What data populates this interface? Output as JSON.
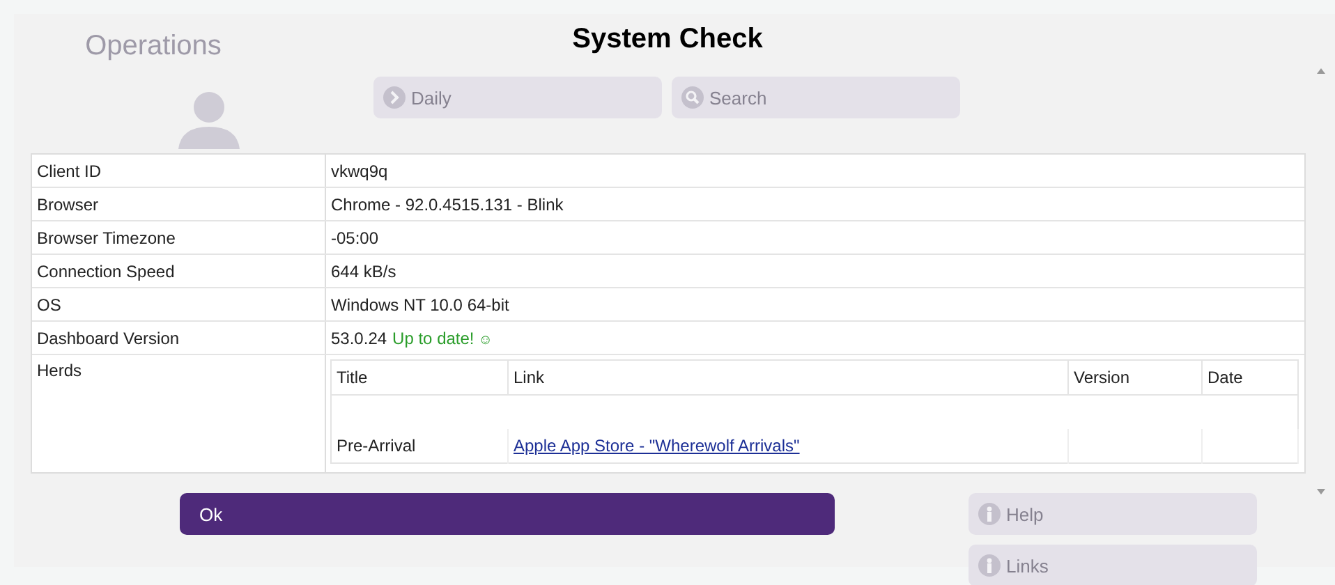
{
  "background_page": {
    "heading": "Operations",
    "buttons": [
      {
        "kind": "chevron",
        "label": "Daily"
      },
      {
        "kind": "search",
        "label": "Search"
      }
    ],
    "side_buttons": [
      {
        "kind": "info",
        "label": "Help"
      },
      {
        "kind": "info",
        "label": "Links"
      }
    ]
  },
  "dialog": {
    "title": "System Check",
    "info_rows": [
      {
        "label": "Client ID",
        "value": "vkwq9q"
      },
      {
        "label": "Browser",
        "value": "Chrome - 92.0.4515.131 - Blink"
      },
      {
        "label": "Browser Timezone",
        "value": "-05:00"
      },
      {
        "label": "Connection Speed",
        "value": "644 kB/s"
      },
      {
        "label": "OS",
        "value": "Windows NT 10.0 64-bit"
      },
      {
        "label": "Dashboard Version",
        "value": "53.0.24",
        "status": "Up to date!",
        "status_icon": "☺"
      }
    ],
    "herds": {
      "label": "Herds",
      "columns": [
        "Title",
        "Link",
        "Version",
        "Date"
      ],
      "rows": [
        {
          "title": "Pre-Arrival",
          "link": "Apple App Store - \"Wherewolf Arrivals\""
        }
      ]
    },
    "ok_button": "Ok"
  }
}
